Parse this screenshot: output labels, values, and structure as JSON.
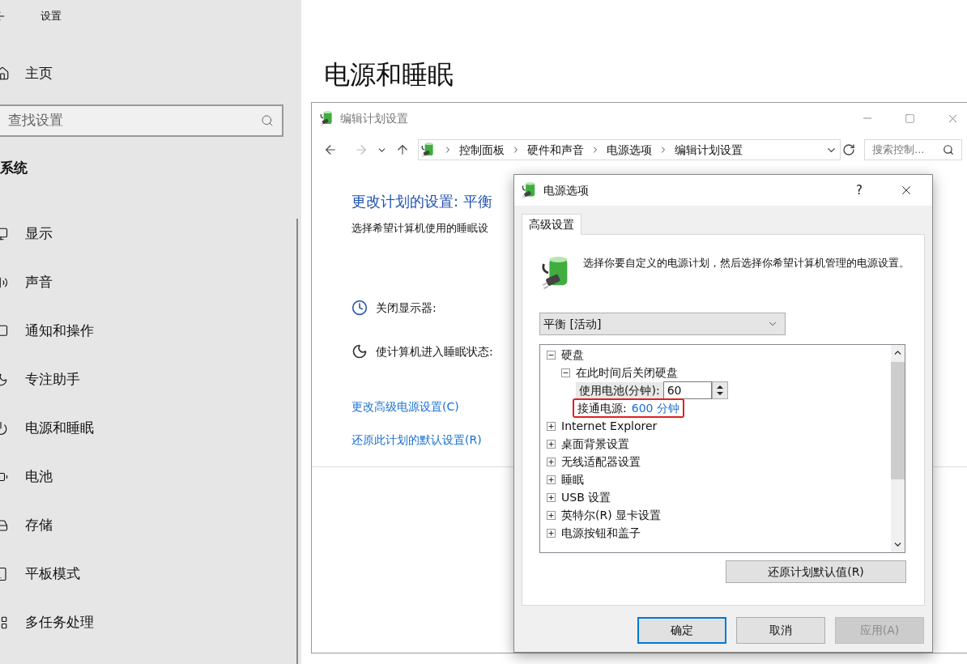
{
  "settings": {
    "title": "设置",
    "home": "主页",
    "search": {
      "placeholder": "查找设置"
    },
    "section": "系统",
    "items": [
      {
        "label": "显示"
      },
      {
        "label": "声音"
      },
      {
        "label": "通知和操作"
      },
      {
        "label": "专注助手"
      },
      {
        "label": "电源和睡眠"
      },
      {
        "label": "电池"
      },
      {
        "label": "存储"
      },
      {
        "label": "平板模式"
      },
      {
        "label": "多任务处理"
      }
    ]
  },
  "page_title": "电源和睡眠",
  "control_panel": {
    "title": "编辑计划设置",
    "breadcrumb": [
      "控制面板",
      "硬件和声音",
      "电源选项",
      "编辑计划设置"
    ],
    "search": {
      "placeholder": "搜索控制..."
    },
    "heading": "更改计划的设置: 平衡",
    "description": "选择希望计算机使用的睡眠设",
    "rows": [
      {
        "label": "关闭显示器:"
      },
      {
        "label": "使计算机进入睡眠状态:"
      }
    ],
    "links": [
      "更改高级电源设置(C)",
      "还原此计划的默认设置(R)"
    ]
  },
  "dialog": {
    "title": "电源选项",
    "help": "?",
    "tabs": [
      {
        "label": "高级设置",
        "selected": true
      }
    ],
    "intro": "选择你要自定义的电源计划，然后选择你希望计算机管理的电源设置。",
    "plan": {
      "value": "平衡 [活动]"
    },
    "tree": [
      {
        "kind": "group",
        "label": "硬盘",
        "expanded": true,
        "children": [
          {
            "kind": "group",
            "label": "在此时间后关闭硬盘",
            "expanded": true,
            "children": [
              {
                "kind": "spinner",
                "label": "使用电池(分钟):",
                "value": "60"
              },
              {
                "kind": "value",
                "label": "接通电源:",
                "value": "600 分钟",
                "highlighted": true
              }
            ]
          }
        ]
      },
      {
        "kind": "group",
        "label": "Internet Explorer",
        "expanded": false
      },
      {
        "kind": "group",
        "label": "桌面背景设置",
        "expanded": false
      },
      {
        "kind": "group",
        "label": "无线适配器设置",
        "expanded": false
      },
      {
        "kind": "group",
        "label": "睡眠",
        "expanded": false
      },
      {
        "kind": "group",
        "label": "USB 设置",
        "expanded": false
      },
      {
        "kind": "group",
        "label": "英特尔(R) 显卡设置",
        "expanded": false
      },
      {
        "kind": "group",
        "label": "电源按钮和盖子",
        "expanded": false
      }
    ],
    "restore_button": "还原计划默认值(R)",
    "buttons": [
      {
        "label": "确定",
        "kind": "default",
        "disabled": false
      },
      {
        "label": "取消",
        "kind": "normal",
        "disabled": false
      },
      {
        "label": "应用(A)",
        "kind": "normal",
        "disabled": true
      }
    ]
  }
}
